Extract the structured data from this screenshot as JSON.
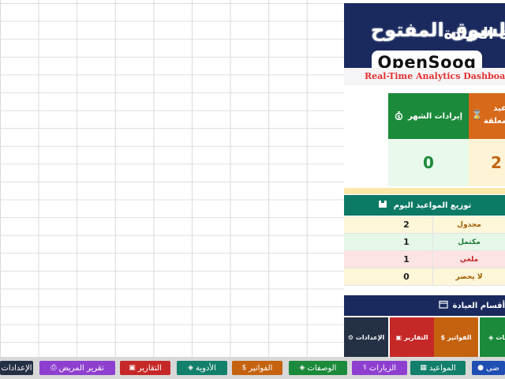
{
  "header": {
    "title": "إدارة العيادة",
    "watermark_ar": "السوق المفتوح",
    "watermark_en": "OpenSooq",
    "subtitle": "Real-Time Analytics Dashboard"
  },
  "cards": {
    "revenue": {
      "label": "إيرادات الشهر",
      "value": "0",
      "icon": "money-bag-icon"
    },
    "pending": {
      "label_line1": "عيد",
      "label_line2": "معلقة",
      "value": "2",
      "icon": "hourglass-icon"
    }
  },
  "distribution": {
    "title": "توزيع المواعيد اليوم",
    "rows": [
      {
        "label": "مجدول",
        "value": "2",
        "bg": "#fdf6d8",
        "color": "#a15c00"
      },
      {
        "label": "مكتمل",
        "value": "1",
        "bg": "#e6f7ea",
        "color": "#1b7a33"
      },
      {
        "label": "ملغي",
        "value": "1",
        "bg": "#fde3e3",
        "color": "#c62828"
      },
      {
        "label": "لا يحضر",
        "value": "0",
        "bg": "#fdf6d8",
        "color": "#a15c00"
      }
    ]
  },
  "sections": {
    "title": "أقسام العيادة",
    "buttons": [
      {
        "label": "صفات",
        "bg": "#1b8a3a",
        "icon": "pill-icon"
      },
      {
        "label": "الفواتير",
        "bg": "#c4620f",
        "icon": "money-bag-icon"
      },
      {
        "label": "التقارير",
        "bg": "#c62828",
        "icon": "folder-icon"
      },
      {
        "label": "الإعدادات",
        "bg": "#243044",
        "icon": "gear-icon"
      }
    ]
  },
  "taskbar": {
    "buttons": [
      {
        "label": "الإعدادات",
        "bg": "#243044",
        "icon": "gear-icon"
      },
      {
        "label": "تقرير المريض",
        "bg": "#8e3fcf",
        "icon": "printer-icon"
      },
      {
        "label": "التقارير",
        "bg": "#c62828",
        "icon": "folder-icon"
      },
      {
        "label": "الأدوية",
        "bg": "#12806a",
        "icon": "pill-icon"
      },
      {
        "label": "الفواتير",
        "bg": "#c4620f",
        "icon": "money-bag-icon"
      },
      {
        "label": "الوصفات",
        "bg": "#1b8a3a",
        "icon": "pill-icon"
      },
      {
        "label": "الزيارات",
        "bg": "#8e3fcf",
        "icon": "stethoscope-icon"
      },
      {
        "label": "المواعيد",
        "bg": "#12806a",
        "icon": "calendar-icon"
      },
      {
        "label": "ضى",
        "bg": "#1f4fb3",
        "icon": "user-icon"
      }
    ]
  }
}
